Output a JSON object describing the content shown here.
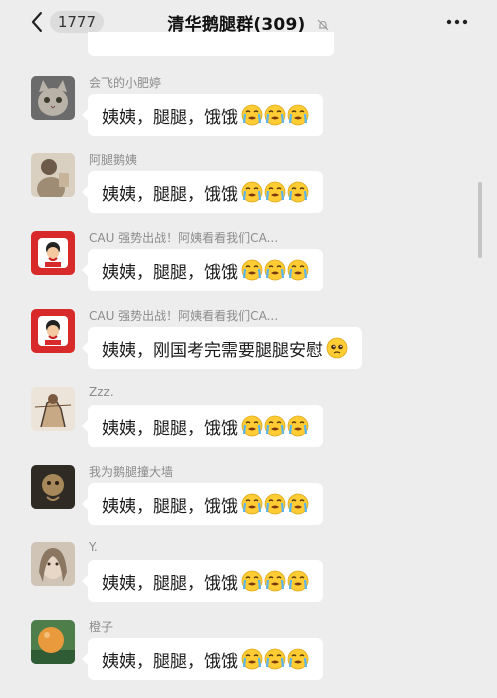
{
  "header": {
    "unread_count": "1777",
    "title": "清华鹅腿群(309)"
  },
  "messages": [
    {
      "sender": "会飞的小肥婷",
      "text": "姨姨，腿腿，饿饿",
      "emoji": [
        "sob-face-icon",
        "sob-face-icon",
        "sob-face-icon"
      ],
      "avatar": "cat-avatar"
    },
    {
      "sender": "阿腿鹅姨",
      "text": "姨姨，腿腿，饿饿",
      "emoji": [
        "sob-face-icon",
        "sob-face-icon",
        "sob-face-icon"
      ],
      "avatar": "figure-avatar"
    },
    {
      "sender": "CAU 强势出战！阿姨看看我们CA...",
      "text": "姨姨，腿腿，饿饿",
      "emoji": [
        "sob-face-icon",
        "sob-face-icon",
        "sob-face-icon"
      ],
      "avatar": "red-cartoon-avatar"
    },
    {
      "sender": "CAU 强势出战！阿姨看看我们CA...",
      "text": "姨姨，刚国考完需要腿腿安慰",
      "emoji": [
        "pleading-face-icon"
      ],
      "avatar": "red-cartoon-avatar"
    },
    {
      "sender": "Zzz.",
      "text": "姨姨，腿腿，饿饿",
      "emoji": [
        "sob-face-icon",
        "sob-face-icon",
        "sob-face-icon"
      ],
      "avatar": "sketch-avatar"
    },
    {
      "sender": "我为鹅腿撞大墙",
      "text": "姨姨，腿腿，饿饿",
      "emoji": [
        "sob-face-icon",
        "sob-face-icon",
        "sob-face-icon"
      ],
      "avatar": "dark-avatar"
    },
    {
      "sender": "Y.",
      "text": "姨姨，腿腿，饿饿",
      "emoji": [
        "sob-face-icon",
        "sob-face-icon",
        "sob-face-icon"
      ],
      "avatar": "portrait-avatar"
    },
    {
      "sender": "橙子",
      "text": "姨姨，腿腿，饿饿",
      "emoji": [
        "sob-face-icon",
        "sob-face-icon",
        "sob-face-icon"
      ],
      "avatar": "orange-avatar"
    }
  ]
}
